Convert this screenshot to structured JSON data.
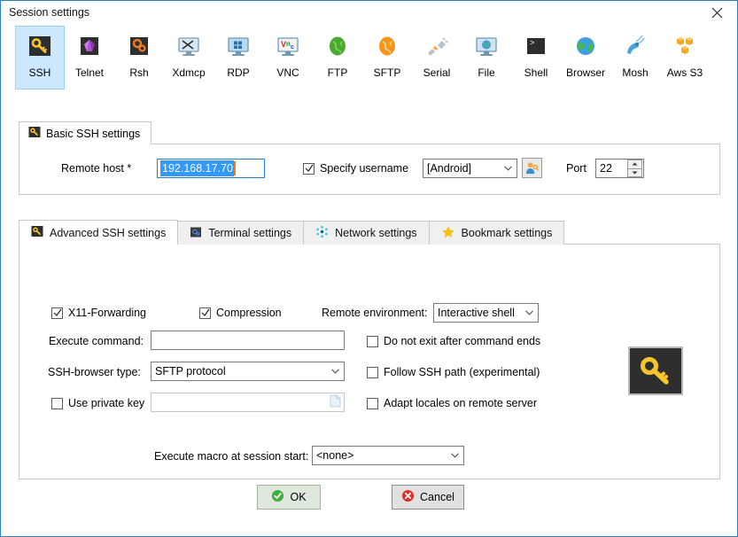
{
  "window": {
    "title": "Session settings",
    "close_icon": "close-icon",
    "border_color": "#2a7fc4"
  },
  "protocols": {
    "selected": "SSH",
    "items": [
      {
        "label": "SSH",
        "icon": "ssh-key-icon"
      },
      {
        "label": "Telnet",
        "icon": "telnet-gem-icon"
      },
      {
        "label": "Rsh",
        "icon": "rsh-gears-icon"
      },
      {
        "label": "Xdmcp",
        "icon": "xdmcp-monitor-icon"
      },
      {
        "label": "RDP",
        "icon": "rdp-windows-monitor-icon"
      },
      {
        "label": "VNC",
        "icon": "vnc-monitor-icon"
      },
      {
        "label": "FTP",
        "icon": "ftp-green-globe-icon"
      },
      {
        "label": "SFTP",
        "icon": "sftp-orange-globe-icon"
      },
      {
        "label": "Serial",
        "icon": "serial-plug-icon"
      },
      {
        "label": "File",
        "icon": "file-globe-monitor-icon"
      },
      {
        "label": "Shell",
        "icon": "shell-terminal-icon"
      },
      {
        "label": "Browser",
        "icon": "browser-globe-icon"
      },
      {
        "label": "Mosh",
        "icon": "mosh-satellite-icon"
      },
      {
        "label": "Aws S3",
        "icon": "aws-s3-cubes-icon"
      }
    ]
  },
  "basic": {
    "group_title": "Basic SSH settings",
    "group_icon": "ssh-key-icon",
    "remote_host_label": "Remote host *",
    "remote_host_value": "192.168.17.70",
    "remote_host_placeholder": "Remote host",
    "specify_username_label": "Specify username",
    "specify_username_checked": true,
    "username_value": "[Android]",
    "username_picker_icon": "user-key-icon",
    "port_label": "Port",
    "port_value": "22"
  },
  "tabs": {
    "selected": "Advanced SSH settings",
    "items": [
      {
        "label": "Advanced SSH settings",
        "icon": "ssh-key-icon"
      },
      {
        "label": "Terminal settings",
        "icon": "terminal-gear-icon"
      },
      {
        "label": "Network settings",
        "icon": "network-nodes-icon"
      },
      {
        "label": "Bookmark settings",
        "icon": "star-icon"
      }
    ]
  },
  "advanced": {
    "x11_label": "X11-Forwarding",
    "x11_checked": true,
    "compression_label": "Compression",
    "compression_checked": true,
    "remote_env_label": "Remote environment:",
    "remote_env_value": "Interactive shell",
    "execute_command_label": "Execute command:",
    "execute_command_value": "",
    "execute_command_placeholder": "",
    "do_not_exit_label": "Do not exit after command ends",
    "do_not_exit_checked": false,
    "ssh_browser_label": "SSH-browser type:",
    "ssh_browser_value": "SFTP protocol",
    "follow_ssh_path_label": "Follow SSH path (experimental)",
    "follow_ssh_path_checked": false,
    "use_private_key_label": "Use private key",
    "use_private_key_checked": false,
    "private_key_value": "",
    "private_key_placeholder": "",
    "private_key_browse_icon": "document-icon",
    "adapt_locales_label": "Adapt locales on remote server",
    "adapt_locales_checked": false,
    "decor_icon": "big-key-icon",
    "macro_label": "Execute macro at session start:",
    "macro_value": "<none>"
  },
  "footer": {
    "ok_label": "OK",
    "ok_icon": "green-check-icon",
    "cancel_label": "Cancel",
    "cancel_icon": "red-x-icon"
  },
  "colors": {
    "selection_blue": "#cce8ff",
    "text_select_blue": "#3399ff",
    "accent_orange": "#f5a623",
    "ok_green": "#3eae3e",
    "cancel_red": "#d9342b"
  }
}
